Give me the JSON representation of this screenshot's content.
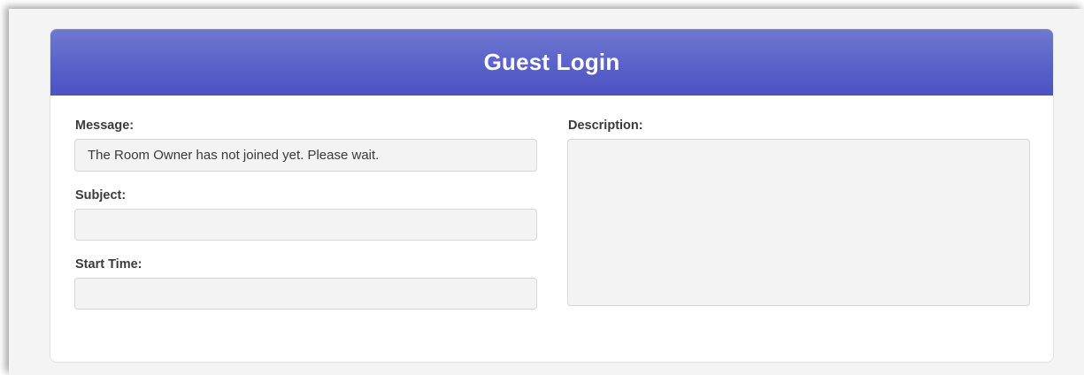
{
  "form": {
    "title": "Guest Login",
    "message": {
      "label": "Message:",
      "value": "The Room Owner has not joined yet. Please wait."
    },
    "subject": {
      "label": "Subject:",
      "value": ""
    },
    "start_time": {
      "label": "Start Time:",
      "value": ""
    },
    "description": {
      "label": "Description:",
      "value": ""
    }
  },
  "colors": {
    "header_top": "#7079d0",
    "header_bottom": "#4c52c2",
    "field_bg": "#f3f3f3"
  }
}
